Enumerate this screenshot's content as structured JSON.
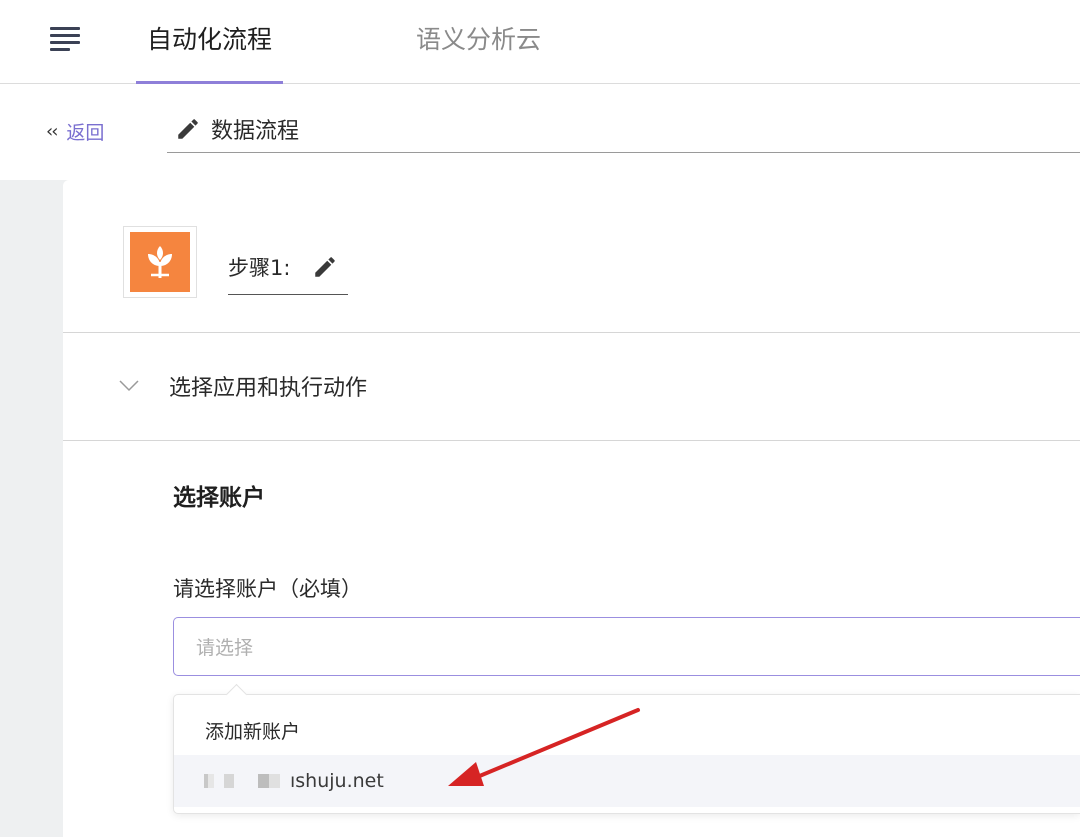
{
  "topbar": {
    "menu_icon": "menu-icon",
    "tabs": [
      {
        "label": "自动化流程",
        "active": true
      },
      {
        "label": "语义分析云",
        "active": false
      }
    ]
  },
  "back": {
    "icon": "double-chevron-left-icon",
    "label": "返回"
  },
  "flow": {
    "icon": "pencil-icon",
    "name": "数据流程"
  },
  "step": {
    "app_icon": "tree-logo-icon",
    "name": "步骤1:",
    "edit_icon": "pencil-icon"
  },
  "section": {
    "icon": "chevron-down-icon",
    "title": "选择应用和执行动作"
  },
  "account": {
    "title": "选择账户",
    "field_label": "请选择账户（必填）",
    "placeholder": "请选择",
    "dropdown": {
      "add_label": "添加新账户",
      "items": [
        {
          "label": "ıshuju.net"
        }
      ]
    }
  },
  "colors": {
    "accent": "#8e7fd9",
    "link": "#7a6fd0",
    "logo": "#f5853f",
    "arrow": "#d62424"
  }
}
